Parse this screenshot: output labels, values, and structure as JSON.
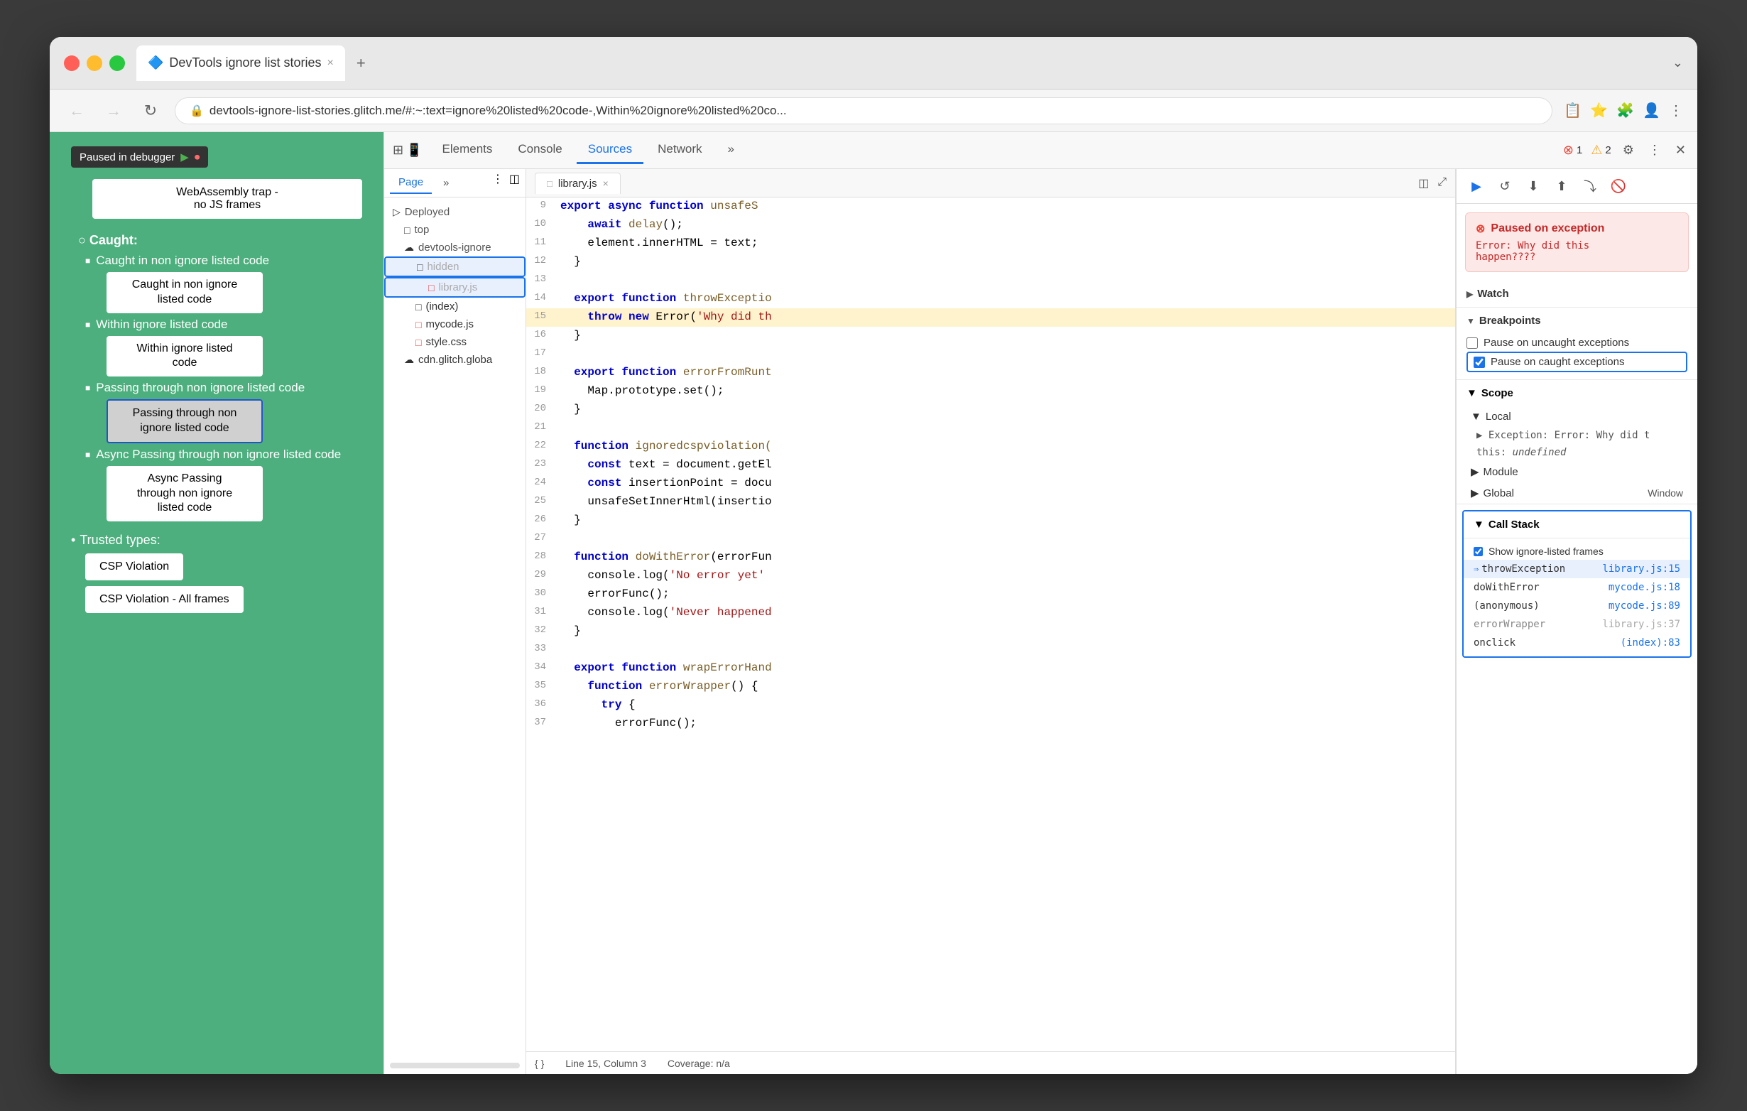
{
  "browser": {
    "traffic_lights": [
      "red",
      "yellow",
      "green"
    ],
    "tab_title": "DevTools ignore list stories",
    "tab_icon": "🔷",
    "tab_close": "×",
    "new_tab": "+",
    "nav": {
      "back": "←",
      "forward": "→",
      "refresh": "↻"
    },
    "url": "devtools-ignore-list-stories.glitch.me/#:~:text=ignore%20listed%20code-,Within%20ignore%20listed%20co...",
    "address_icons": [
      "📋",
      "⭐",
      "🧩",
      "👤"
    ]
  },
  "webpage": {
    "debugger_badge": "Paused in debugger",
    "webassembly_box": "WebAssembly trap -\nno JS frames",
    "caught_section": "Caught:",
    "items": [
      {
        "label": "Caught in non ignore listed code",
        "btn": "Caught in non ignore\nlisted code",
        "highlighted": false
      },
      {
        "label": "Within ignore listed code",
        "btn": "Within ignore listed\ncode",
        "highlighted": false
      },
      {
        "label": "Passing through non ignore listed code",
        "btn": "Passing through non\nignore listed code",
        "highlighted": true
      },
      {
        "label": "Async Passing through non ignore listed code",
        "btn": "Async Passing\nthrough non ignore\nlisted code",
        "highlighted": false
      }
    ],
    "trusted_types": "Trusted types:",
    "csp_buttons": [
      "CSP Violation",
      "CSP Violation - All frames"
    ]
  },
  "devtools": {
    "tabs": [
      "Elements",
      "Console",
      "Sources",
      "Network",
      "»"
    ],
    "active_tab": "Sources",
    "error_count": "1",
    "warning_count": "2",
    "icons": [
      "⚙",
      "⋮",
      "✕"
    ]
  },
  "sources": {
    "sidebar_tabs": [
      "Page",
      "»"
    ],
    "tree": {
      "deployed": "Deployed",
      "top": "top",
      "devtools_ignore": "devtools-ignore",
      "hidden": "hidden",
      "library": "library.js",
      "index": "(index)",
      "mycode": "mycode.js",
      "style": "style.css",
      "cdn": "cdn.glitch.globa"
    },
    "editor_file": "library.js",
    "lines": [
      {
        "num": 9,
        "content": "  export async function unsafeS",
        "highlight": false
      },
      {
        "num": 10,
        "content": "    await delay();",
        "highlight": false
      },
      {
        "num": 11,
        "content": "    element.innerHTML = text;",
        "highlight": false
      },
      {
        "num": 12,
        "content": "  }",
        "highlight": false
      },
      {
        "num": 13,
        "content": "",
        "highlight": false
      },
      {
        "num": 14,
        "content": "  export function throwExceptio",
        "highlight": false
      },
      {
        "num": 15,
        "content": "    throw new Error('Why did th",
        "highlight": true
      },
      {
        "num": 16,
        "content": "  }",
        "highlight": false
      },
      {
        "num": 17,
        "content": "",
        "highlight": false
      },
      {
        "num": 18,
        "content": "  export function errorFromRunt",
        "highlight": false
      },
      {
        "num": 19,
        "content": "    Map.prototype.set();",
        "highlight": false
      },
      {
        "num": 20,
        "content": "  }",
        "highlight": false
      },
      {
        "num": 21,
        "content": "",
        "highlight": false
      },
      {
        "num": 22,
        "content": "  function ignoredcspviolation(",
        "highlight": false
      },
      {
        "num": 23,
        "content": "    const text = document.getEl",
        "highlight": false
      },
      {
        "num": 24,
        "content": "    const insertionPoint = docu",
        "highlight": false
      },
      {
        "num": 25,
        "content": "    unsafeSetInnerHtml(insertio",
        "highlight": false
      },
      {
        "num": 26,
        "content": "  }",
        "highlight": false
      },
      {
        "num": 27,
        "content": "",
        "highlight": false
      },
      {
        "num": 28,
        "content": "  function doWithError(errorFun",
        "highlight": false
      },
      {
        "num": 29,
        "content": "    console.log('No error yet'",
        "highlight": false
      },
      {
        "num": 30,
        "content": "    errorFunc();",
        "highlight": false
      },
      {
        "num": 31,
        "content": "    console.log('Never happened",
        "highlight": false
      },
      {
        "num": 32,
        "content": "  }",
        "highlight": false
      },
      {
        "num": 33,
        "content": "",
        "highlight": false
      },
      {
        "num": 34,
        "content": "  export function wrapErrorHand",
        "highlight": false
      },
      {
        "num": 35,
        "content": "    function errorWrapper() {",
        "highlight": false
      },
      {
        "num": 36,
        "content": "      try {",
        "highlight": false
      },
      {
        "num": 37,
        "content": "        errorFunc();",
        "highlight": false
      }
    ],
    "status": {
      "line_col": "Line 15, Column 3",
      "coverage": "Coverage: n/a"
    }
  },
  "debugger": {
    "controls": [
      "▶",
      "↺",
      "⬇",
      "⬆",
      "⤵",
      "🚫"
    ],
    "exception_banner": {
      "title": "Paused on exception",
      "error": "Error: Why did this\nhappen????"
    },
    "sections": {
      "watch": "Watch",
      "breakpoints": "Breakpoints",
      "breakpoints_items": [
        {
          "label": "Pause on uncaught exceptions",
          "checked": false
        },
        {
          "label": "Pause on caught exceptions",
          "checked": true,
          "highlighted": true
        }
      ],
      "scope": "Scope",
      "local": "Local",
      "scope_items": [
        {
          "key": "▶ Exception: Error: Why did t",
          "val": ""
        },
        {
          "key": "this:",
          "val": "undefined"
        }
      ],
      "module": "Module",
      "global": "Global",
      "global_val": "Window"
    },
    "call_stack": {
      "title": "Call Stack",
      "show_ignore": "Show ignore-listed frames",
      "show_ignore_checked": true,
      "frames": [
        {
          "name": "throwException",
          "loc": "library.js:15",
          "current": true,
          "dim": false
        },
        {
          "name": "doWithError",
          "loc": "mycode.js:18",
          "current": false,
          "dim": false
        },
        {
          "name": "(anonymous)",
          "loc": "mycode.js:89",
          "current": false,
          "dim": false
        },
        {
          "name": "errorWrapper",
          "loc": "library.js:37",
          "current": false,
          "dim": true
        },
        {
          "name": "onclick",
          "loc": "(index):83",
          "current": false,
          "dim": false
        }
      ]
    }
  }
}
